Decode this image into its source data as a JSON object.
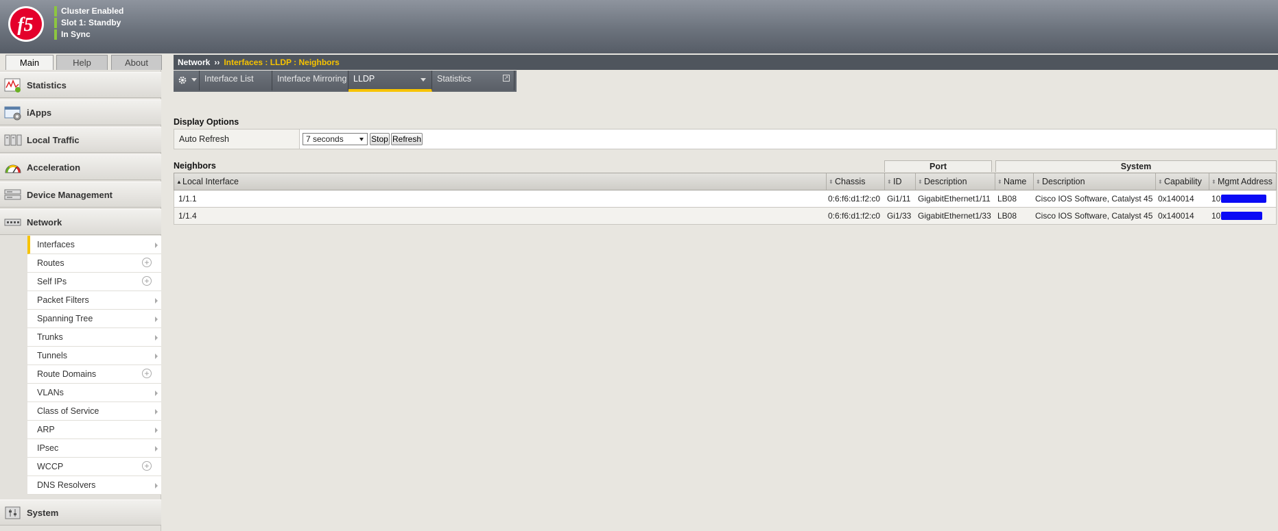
{
  "header": {
    "logo_text": "f5",
    "status": [
      "Cluster Enabled",
      "Slot 1: Standby",
      "In Sync"
    ],
    "colors": {
      "status_ok": "#8dc63f",
      "accent": "#f7c300",
      "logo_red": "#e4002b"
    }
  },
  "main_tabs": [
    {
      "label": "Main",
      "active": true
    },
    {
      "label": "Help",
      "active": false
    },
    {
      "label": "About",
      "active": false
    }
  ],
  "sidebar": {
    "sections": [
      {
        "label": "Statistics",
        "icon": "statistics-icon"
      },
      {
        "label": "iApps",
        "icon": "iapps-icon"
      },
      {
        "label": "Local Traffic",
        "icon": "local-traffic-icon"
      },
      {
        "label": "Acceleration",
        "icon": "acceleration-icon"
      },
      {
        "label": "Device Management",
        "icon": "device-management-icon"
      },
      {
        "label": "Network",
        "icon": "network-icon"
      }
    ],
    "network_items": [
      {
        "label": "Interfaces",
        "control": "arrow",
        "active": true
      },
      {
        "label": "Routes",
        "control": "plus"
      },
      {
        "label": "Self IPs",
        "control": "plus"
      },
      {
        "label": "Packet Filters",
        "control": "arrow"
      },
      {
        "label": "Spanning Tree",
        "control": "arrow"
      },
      {
        "label": "Trunks",
        "control": "arrow"
      },
      {
        "label": "Tunnels",
        "control": "arrow"
      },
      {
        "label": "Route Domains",
        "control": "plus"
      },
      {
        "label": "VLANs",
        "control": "arrow"
      },
      {
        "label": "Class of Service",
        "control": "arrow"
      },
      {
        "label": "ARP",
        "control": "arrow"
      },
      {
        "label": "IPsec",
        "control": "arrow"
      },
      {
        "label": "WCCP",
        "control": "plus"
      },
      {
        "label": "DNS Resolvers",
        "control": "arrow"
      }
    ],
    "bottom_section": {
      "label": "System",
      "icon": "system-icon"
    }
  },
  "breadcrumb": {
    "root": "Network",
    "separator": "››",
    "path": "Interfaces : LLDP : Neighbors"
  },
  "sub_tabs": {
    "gear": "gear-icon",
    "items": [
      {
        "label": "Interface List"
      },
      {
        "label": "Interface Mirroring"
      },
      {
        "label": "LLDP",
        "active": true,
        "dropdown": true
      },
      {
        "label": "Statistics",
        "popout": true
      }
    ]
  },
  "display_options": {
    "title": "Display Options",
    "auto_refresh_label": "Auto Refresh",
    "auto_refresh_value": "7 seconds",
    "stop_label": "Stop",
    "refresh_label": "Refresh"
  },
  "neighbors": {
    "title": "Neighbors",
    "group_headers": {
      "port": "Port",
      "system": "System"
    },
    "columns": [
      "Local Interface",
      "Chassis",
      "ID",
      "Description",
      "Name",
      "Description",
      "Capability",
      "Mgmt Address"
    ],
    "rows": [
      [
        "1/1.1",
        "0:6:f6:d1:f2:c0",
        "Gi1/11",
        "GigabitEthernet1/11",
        "LB08",
        "Cisco IOS Software, Catalyst 45",
        "0x140014",
        "10."
      ],
      [
        "1/1.4",
        "0:6:f6:d1:f2:c0",
        "Gi1/33",
        "GigabitEthernet1/33",
        "LB08",
        "Cisco IOS Software, Catalyst 45",
        "0x140014",
        "10."
      ]
    ]
  }
}
